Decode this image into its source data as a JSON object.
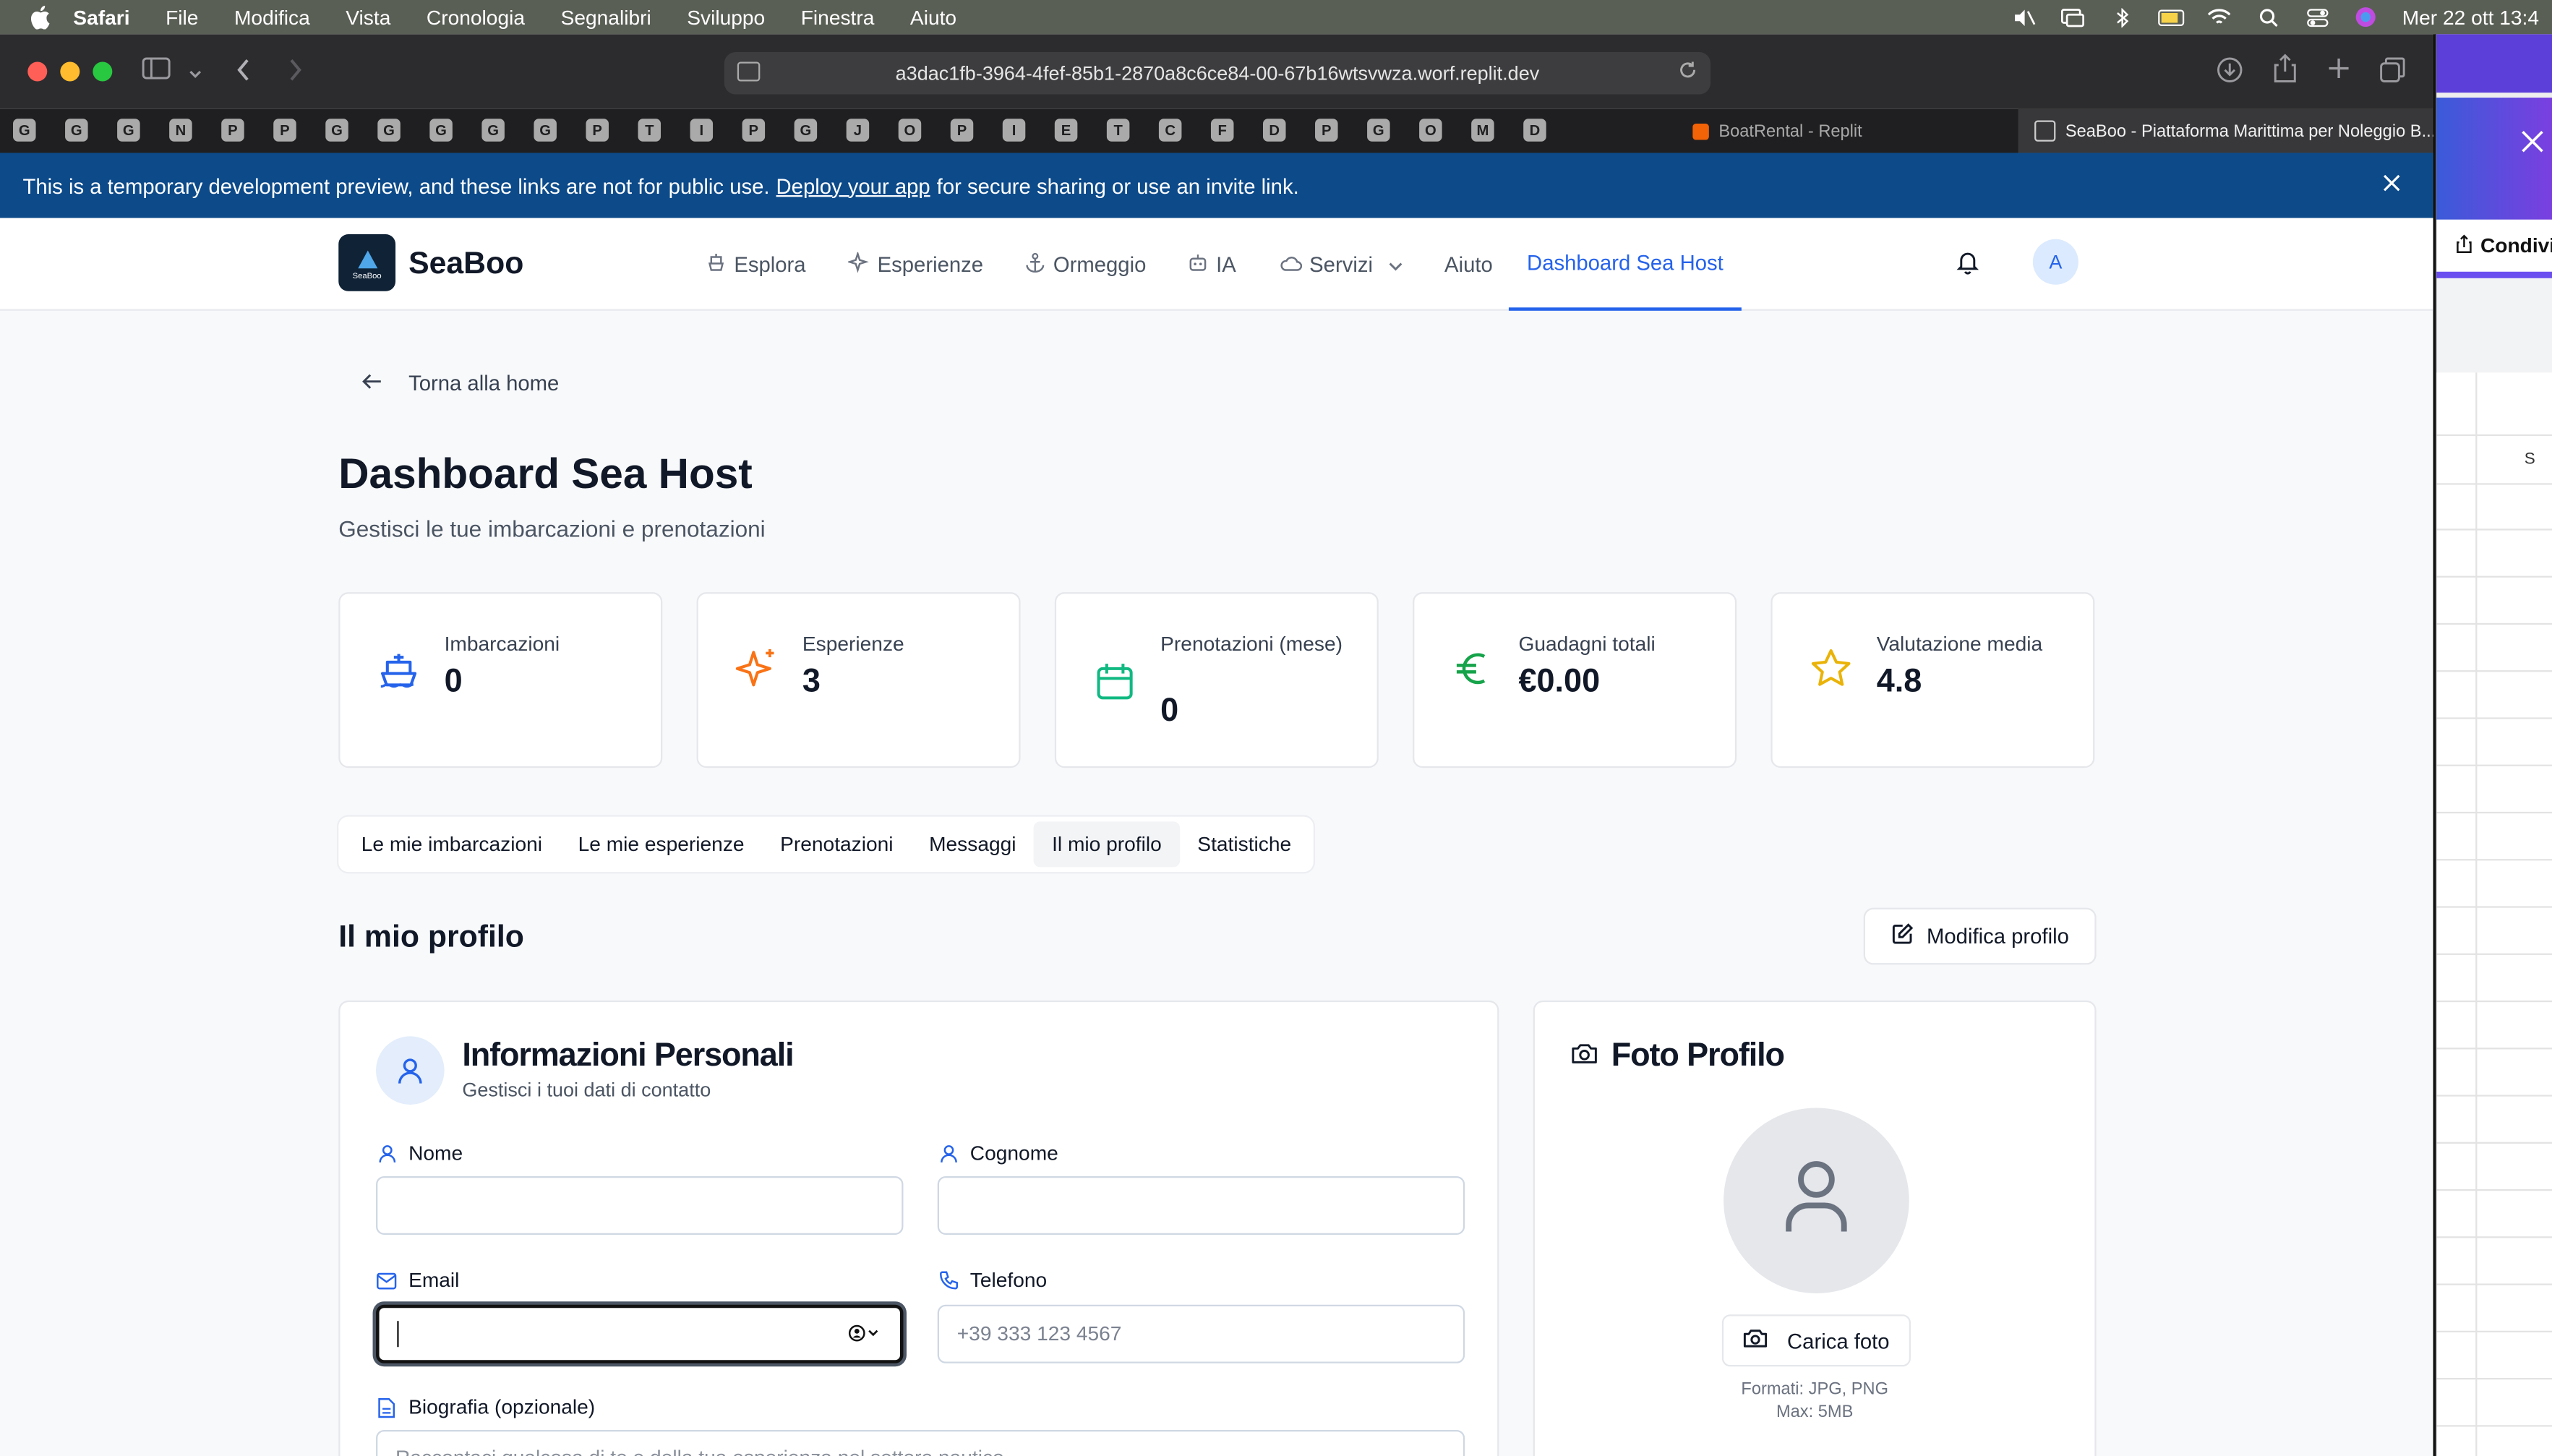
{
  "menubar": {
    "app": "Safari",
    "items": [
      "File",
      "Modifica",
      "Vista",
      "Cronologia",
      "Segnalibri",
      "Sviluppo",
      "Finestra",
      "Aiuto"
    ],
    "datetime": "Mer 22 ott  13:4"
  },
  "browser": {
    "url": "a3dac1fb-3964-4fef-85b1-2870a8c6ce84-00-67b16wtsvwza.worf.replit.dev",
    "pinned_tabs": [
      "G",
      "G",
      "G",
      "N",
      "P",
      "P",
      "G",
      "G",
      "G",
      "G",
      "G",
      "P",
      "T",
      "I",
      "P",
      "G",
      "J",
      "O",
      "P",
      "I",
      "E",
      "T",
      "C",
      "F",
      "D",
      "P",
      "G",
      "O",
      "M",
      "D"
    ],
    "tab_other": "BoatRental - Replit",
    "tab_active": "SeaBoo - Piattaforma Marittima per Noleggio B..."
  },
  "banner": {
    "text_before": "This is a temporary development preview, and these links are not for public use.",
    "link": "Deploy your app",
    "text_after": "for secure sharing or use an invite link."
  },
  "site": {
    "logo_text": "SeaBoo",
    "brand": "SeaBoo",
    "nav": {
      "esplora": "Esplora",
      "esperienze": "Esperienze",
      "ormeggio": "Ormeggio",
      "ia": "IA",
      "servizi": "Servizi",
      "aiuto": "Aiuto",
      "dashboard": "Dashboard Sea Host"
    },
    "avatar": "A"
  },
  "page": {
    "back": "Torna alla home",
    "title": "Dashboard Sea Host",
    "subtitle": "Gestisci le tue imbarcazioni e prenotazioni"
  },
  "stats": [
    {
      "label": "Imbarcazioni",
      "value": "0",
      "color": "#2563eb"
    },
    {
      "label": "Esperienze",
      "value": "3",
      "color": "#f97316"
    },
    {
      "label": "Prenotazioni (mese)",
      "value": "0",
      "color": "#10b981"
    },
    {
      "label": "Guadagni totali",
      "value": "€0.00",
      "color": "#16a34a"
    },
    {
      "label": "Valutazione media",
      "value": "4.8",
      "color": "#eab308"
    }
  ],
  "tabs": [
    "Le mie imbarcazioni",
    "Le mie esperienze",
    "Prenotazioni",
    "Messaggi",
    "Il mio profilo",
    "Statistiche"
  ],
  "profile": {
    "heading": "Il mio profilo",
    "edit_button": "Modifica profilo",
    "info_title": "Informazioni Personali",
    "info_subtitle": "Gestisci i tuoi dati di contatto",
    "nome_label": "Nome",
    "nome_value": "",
    "cognome_label": "Cognome",
    "cognome_value": "",
    "email_label": "Email",
    "email_value": "",
    "telefono_label": "Telefono",
    "telefono_placeholder": "+39 333 123 4567",
    "bio_label": "Biografia (opzionale)",
    "bio_placeholder": "Raccontaci qualcosa di te e della tua esperienza nel settore nautico"
  },
  "photo": {
    "title": "Foto Profilo",
    "upload": "Carica foto",
    "formats": "Formati: JPG, PNG",
    "max": "Max: 5MB"
  },
  "other_window": {
    "share": "Condivid",
    "col": "S"
  }
}
